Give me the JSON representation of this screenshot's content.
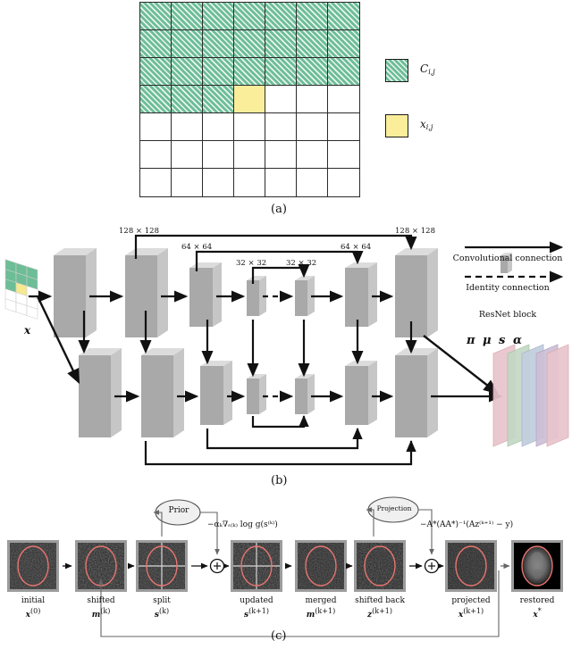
{
  "figure": {
    "panel_labels": {
      "a": "(a)",
      "b": "(b)",
      "c": "(c)"
    }
  },
  "panel_a": {
    "grid": {
      "rows": 7,
      "cols": 7,
      "green_full_rows": 3,
      "green_partial_row_cells": 3,
      "highlight_cell": {
        "row": 4,
        "col": 4
      }
    },
    "legend": [
      {
        "swatch": "green-hatched",
        "label": "C",
        "sub": "i,j"
      },
      {
        "swatch": "yellow",
        "label": "x",
        "sub": "i,j"
      }
    ]
  },
  "panel_b": {
    "input_label": "x",
    "resolutions": [
      "128 × 128",
      "64 × 64",
      "32 × 32",
      "32 × 32",
      "64 × 64",
      "128 × 128"
    ],
    "legend": {
      "conv": "Convolutional connection",
      "identity": "Identity connection",
      "resnet": "ResNet block"
    },
    "output_planes": [
      {
        "symbol": "π",
        "color": "#e8c5cc"
      },
      {
        "symbol": "μ",
        "color": "#c3d8c4"
      },
      {
        "symbol": "s",
        "color": "#c2cede"
      },
      {
        "symbol": "α",
        "color": "#cdbfd6"
      }
    ]
  },
  "panel_c": {
    "steps": [
      {
        "name": "initial",
        "symbol": "x",
        "sup": "(0)",
        "image": "noisy-ellipse"
      },
      {
        "name": "shifted",
        "symbol": "m",
        "sup": "(k)",
        "image": "noisy-ellipse"
      },
      {
        "name": "split",
        "symbol": "s",
        "sup": "(k)",
        "image": "noisy-ellipse-split"
      },
      {
        "name": "updated",
        "symbol": "s",
        "sup": "(k+1)",
        "image": "noisy-ellipse-split"
      },
      {
        "name": "merged",
        "symbol": "m",
        "sup": "(k+1)",
        "image": "noisy-ellipse"
      },
      {
        "name": "shifted back",
        "symbol": "z",
        "sup": "(k+1)",
        "image": "noisy-ellipse"
      },
      {
        "name": "projected",
        "symbol": "x",
        "sup": "(k+1)",
        "image": "noisy-ellipse"
      },
      {
        "name": "restored",
        "symbol": "x",
        "sup": "*",
        "image": "brain-mri"
      }
    ],
    "nodes": [
      {
        "id": "prior",
        "label": "Prior"
      },
      {
        "id": "projection",
        "label": "Projection"
      }
    ],
    "formulas": [
      {
        "id": "prior-grad",
        "text": "−αₖ∇ₛ₍ₖ₎ log g(s⁽ᵏ⁾)"
      },
      {
        "id": "projection-step",
        "text": "−A*(AA*)⁻¹(Az⁽ᵏ⁺¹⁾ − y)"
      }
    ],
    "operators": [
      "+",
      "+"
    ]
  }
}
